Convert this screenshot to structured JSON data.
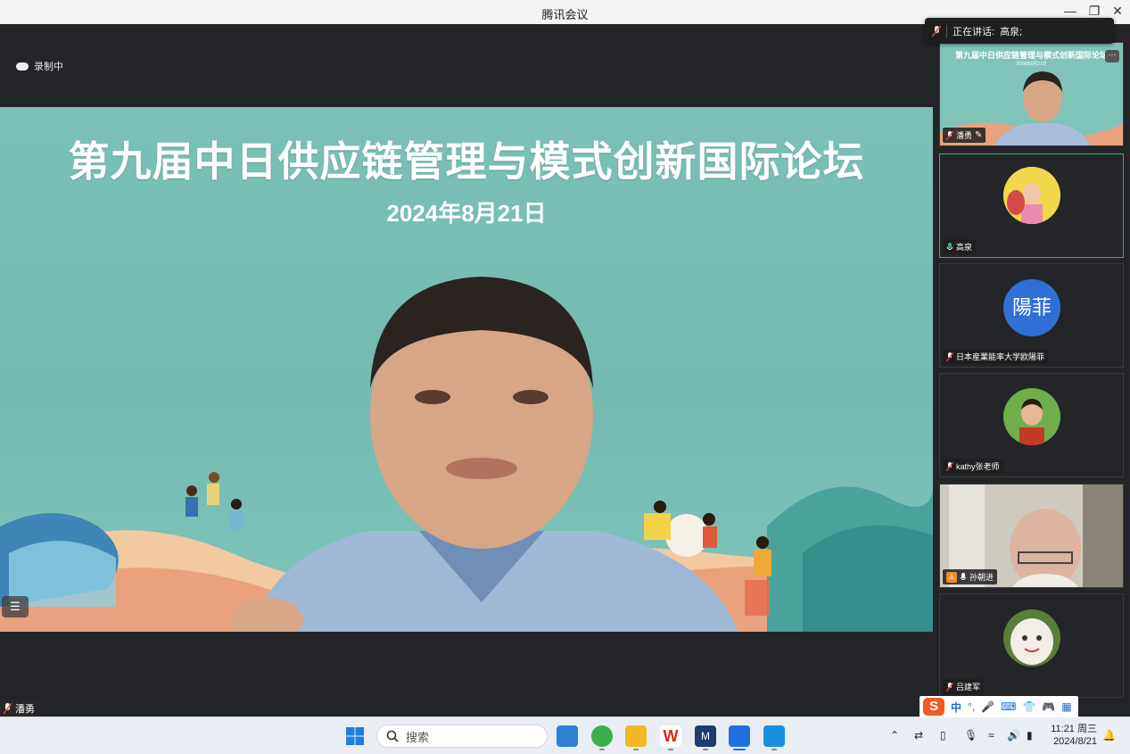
{
  "window": {
    "title": "腾讯会议"
  },
  "recording": {
    "label": "录制中"
  },
  "speaking": {
    "label": "正在讲话:",
    "name": "高泉;"
  },
  "slide": {
    "title": "第九届中日供应链管理与模式创新国际论坛",
    "date": "2024年8月21日"
  },
  "main_speaker": {
    "name": "潘勇"
  },
  "participants": [
    {
      "name": "潘勇",
      "slide_title": "第九届中日供应链管理与模式创新国际论坛",
      "slide_date": "2024年8月21日"
    },
    {
      "name": "高泉"
    },
    {
      "name": "日本産業能率大学欧陽菲",
      "avatar_text": "陽菲"
    },
    {
      "name": "kathy张老师"
    },
    {
      "name": "孙朝进"
    },
    {
      "name": "吕建军"
    }
  ],
  "ime": {
    "mode": "中",
    "punct": "°,"
  },
  "taskbar": {
    "search_placeholder": "搜索"
  },
  "clock": {
    "time": "11:21 周三",
    "date": "2024/8/21"
  },
  "colors": {
    "accent_green": "#3fae6a",
    "slide_bg": "#7bc0b6",
    "avatar_blue": "#2f6fd6"
  }
}
